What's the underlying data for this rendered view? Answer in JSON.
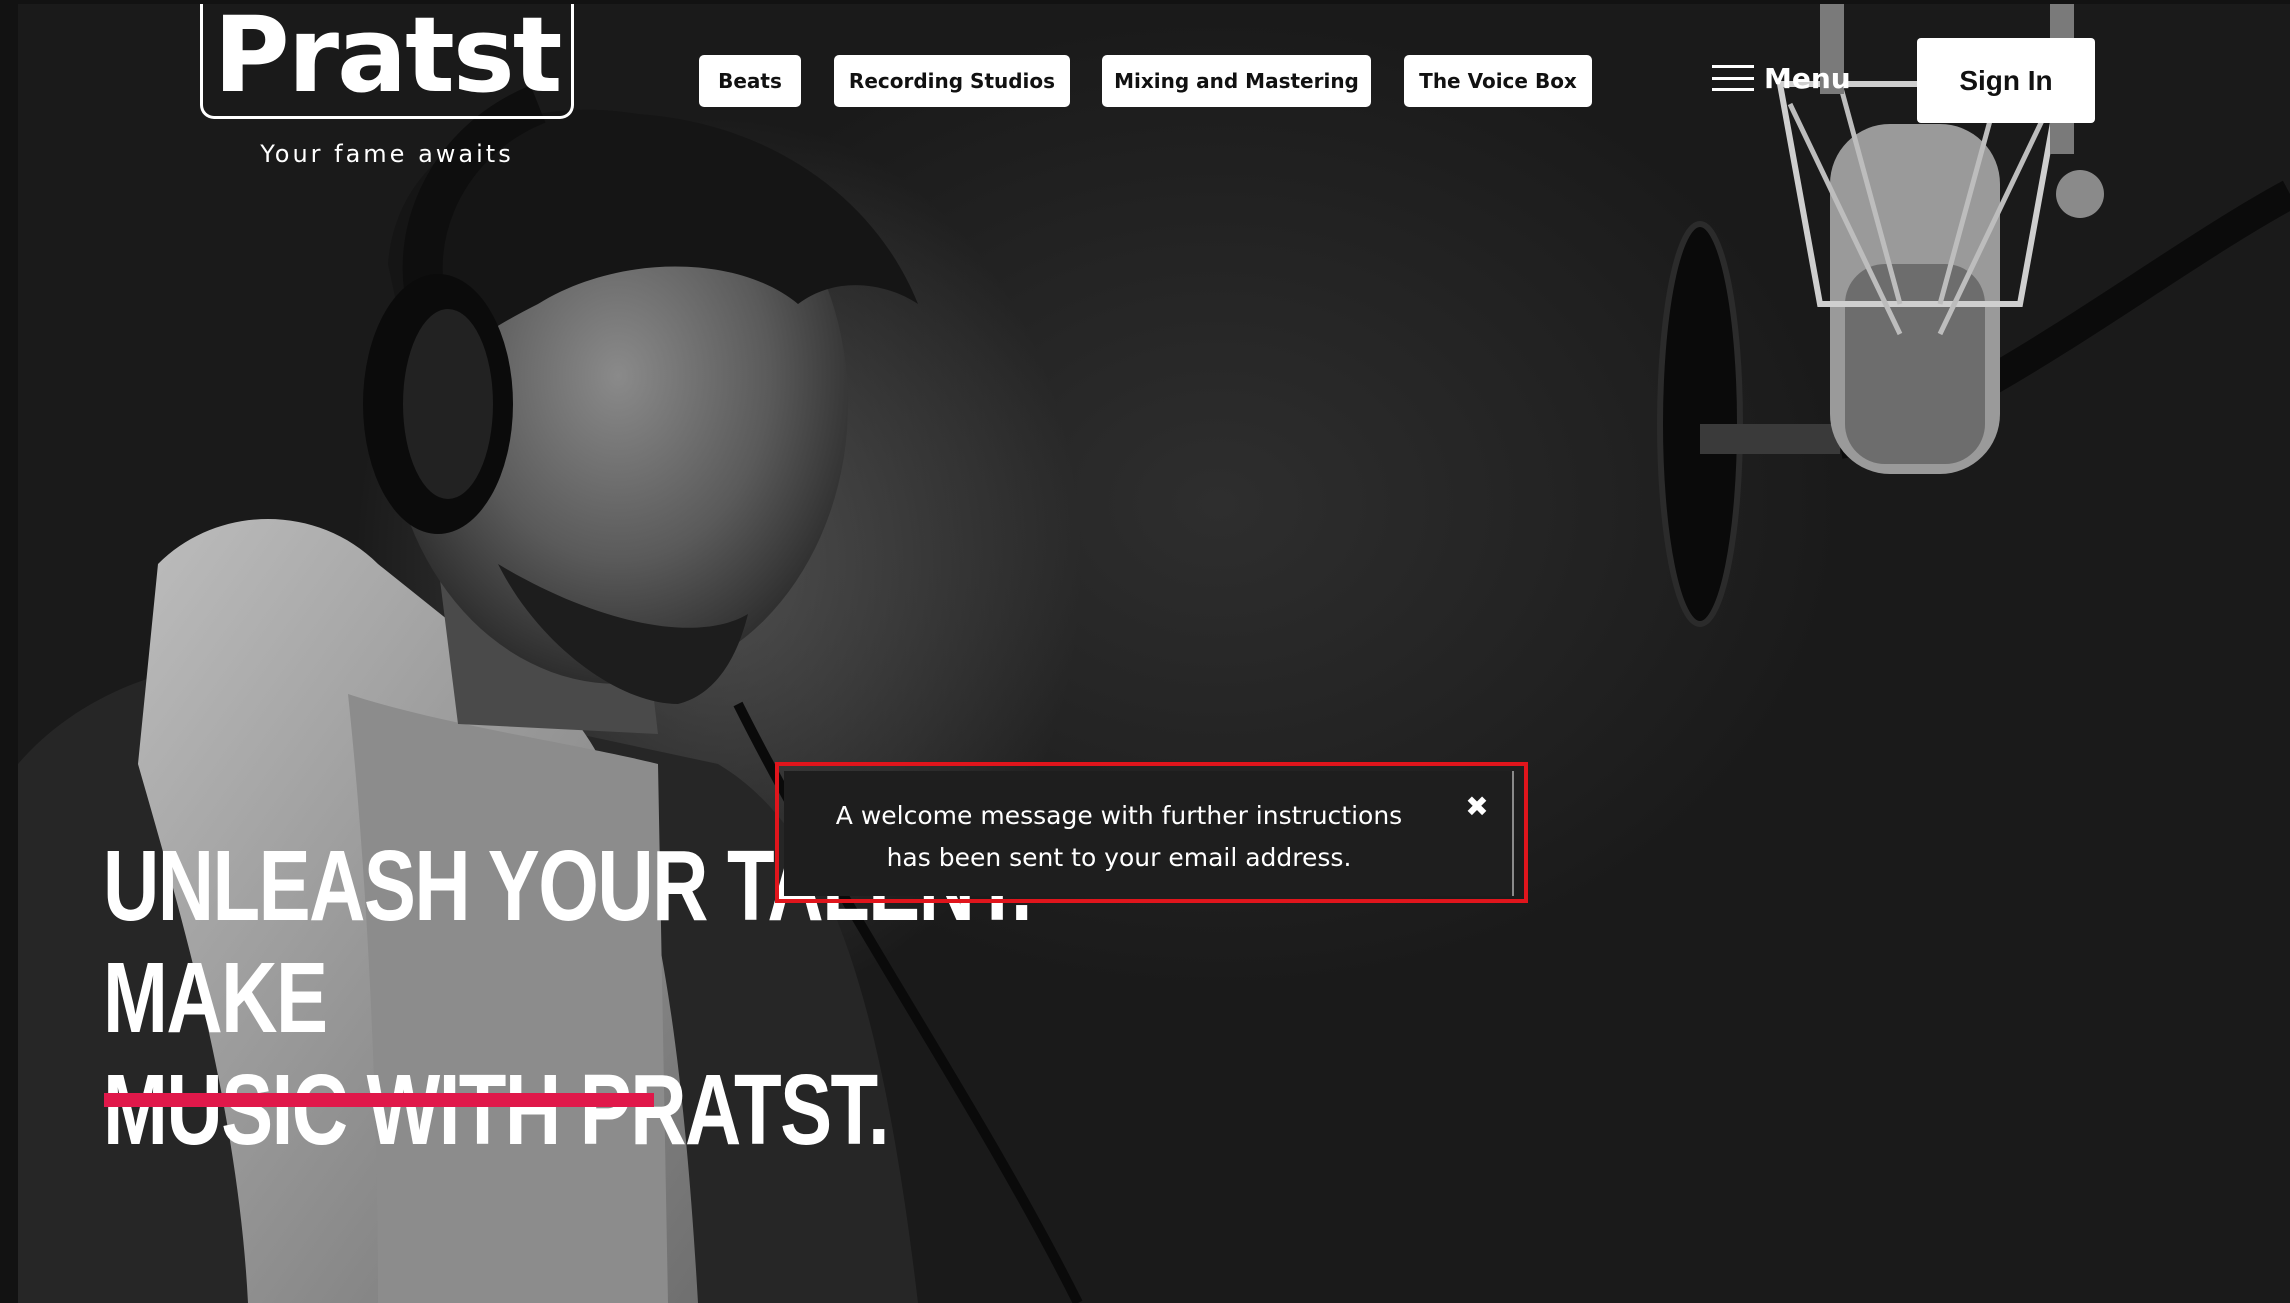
{
  "header": {
    "logo_text": "Pratst",
    "tagline": "Your fame awaits",
    "nav": [
      {
        "label": "Beats"
      },
      {
        "label": "Recording Studios"
      },
      {
        "label": "Mixing and Mastering"
      },
      {
        "label": "The Voice Box"
      }
    ],
    "menu_label": "Menu",
    "signin_label": "Sign In"
  },
  "hero": {
    "headline_line1": "Unleash your talent. Make",
    "headline_line2": "music with Pratst.",
    "accent_color": "#e0184a"
  },
  "notification": {
    "line1": "A welcome message with further instructions",
    "line2": "has been sent to your email address.",
    "close_icon": "close-icon",
    "highlight_color": "#e0151c"
  }
}
